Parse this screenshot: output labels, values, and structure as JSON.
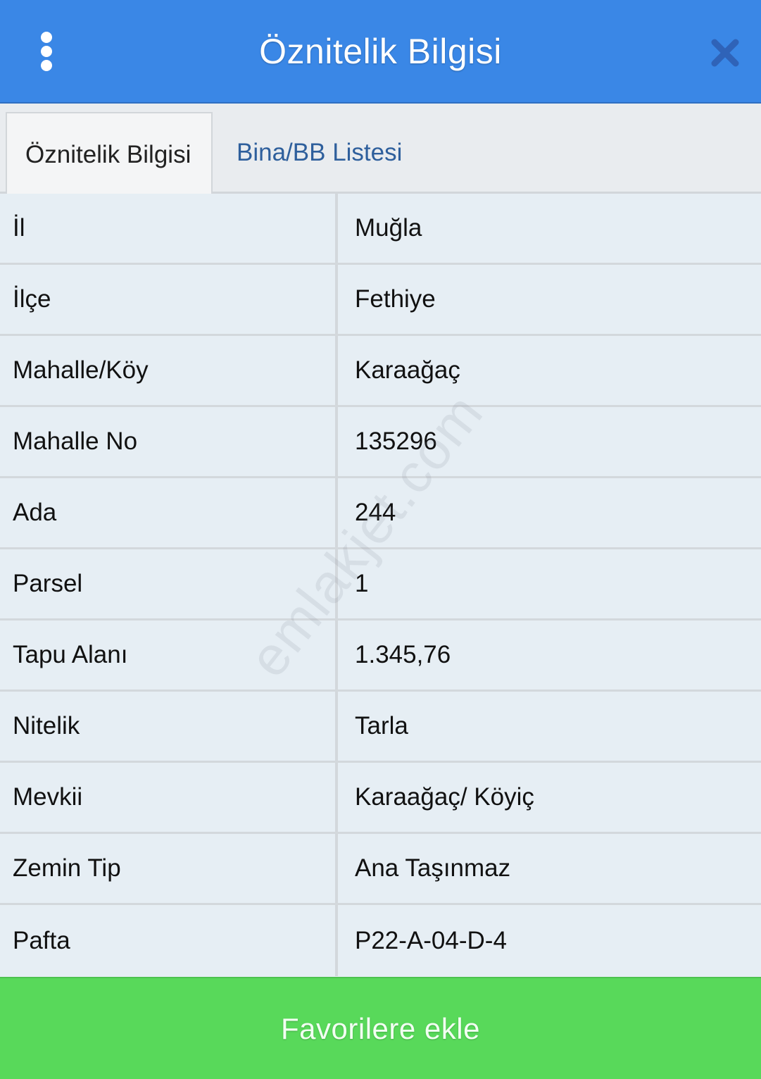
{
  "header": {
    "title": "Öznitelik Bilgisi",
    "menu_icon": "kebab-menu-icon",
    "close_icon": "close-icon"
  },
  "tabs": [
    {
      "label": "Öznitelik Bilgisi",
      "active": true
    },
    {
      "label": "Bina/BB Listesi",
      "active": false
    }
  ],
  "rows": [
    {
      "label": "İl",
      "value": "Muğla"
    },
    {
      "label": "İlçe",
      "value": "Fethiye"
    },
    {
      "label": "Mahalle/Köy",
      "value": "Karaağaç"
    },
    {
      "label": "Mahalle No",
      "value": "135296"
    },
    {
      "label": "Ada",
      "value": "244"
    },
    {
      "label": "Parsel",
      "value": "1"
    },
    {
      "label": "Tapu Alanı",
      "value": "1.345,76"
    },
    {
      "label": "Nitelik",
      "value": "Tarla"
    },
    {
      "label": "Mevkii",
      "value": "Karaağaç/ Köyiç"
    },
    {
      "label": "Zemin Tip",
      "value": "Ana Taşınmaz"
    },
    {
      "label": "Pafta",
      "value": "P22-A-04-D-4"
    }
  ],
  "footer": {
    "button_label": "Favorilere ekle"
  },
  "watermark": "emlakjet.com",
  "colors": {
    "header_bg": "#3a87e6",
    "button_bg": "#58d95a",
    "row_bg": "#e6eef4"
  }
}
